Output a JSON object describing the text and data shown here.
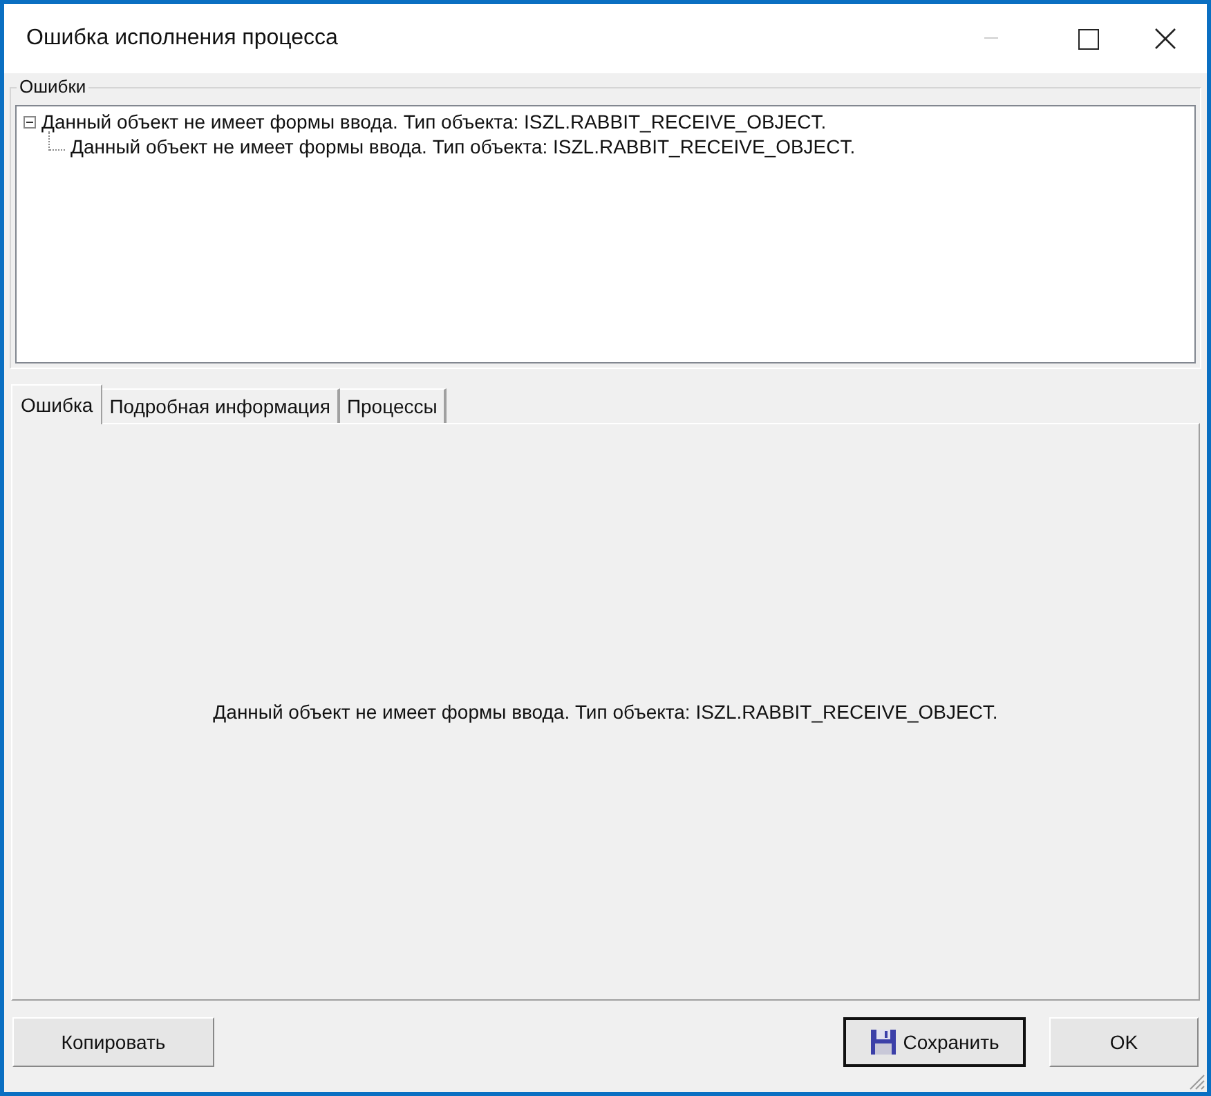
{
  "window": {
    "title": "Ошибка исполнения процесса"
  },
  "errors_group": {
    "label": "Ошибки",
    "tree": [
      {
        "text": "Данный объект не имеет формы ввода. Тип объекта: ISZL.RABBIT_RECEIVE_OBJECT.",
        "expanded": true,
        "children": [
          {
            "text": "Данный объект не имеет формы ввода. Тип объекта: ISZL.RABBIT_RECEIVE_OBJECT."
          }
        ]
      }
    ]
  },
  "tabs": [
    {
      "label": "Ошибка",
      "selected": true
    },
    {
      "label": "Подробная информация",
      "selected": false
    },
    {
      "label": "Процессы",
      "selected": false
    }
  ],
  "tab_content": {
    "message": "Данный объект не имеет формы ввода. Тип объекта: ISZL.RABBIT_RECEIVE_OBJECT."
  },
  "buttons": [
    {
      "label": "Копировать",
      "kind": "plain"
    },
    {
      "label": "Сохранить",
      "kind": "save",
      "default": true
    },
    {
      "label": "OK",
      "kind": "plain",
      "default": false
    }
  ]
}
